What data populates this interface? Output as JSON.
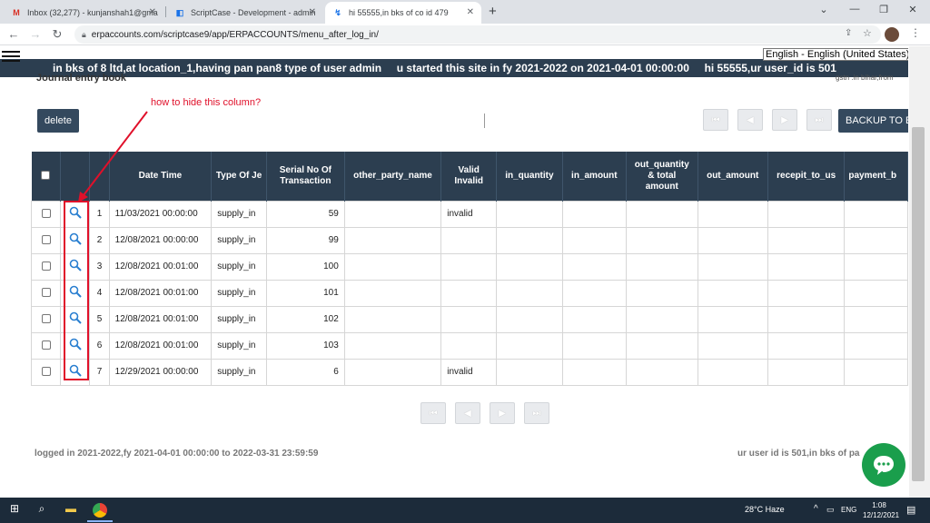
{
  "browser": {
    "tabs": [
      {
        "title": "Inbox (32,277) - kunjanshah1@gma",
        "icon": "gmail-icon",
        "active": false
      },
      {
        "title": "ScriptCase - Development - admin",
        "icon": "scriptcase-icon",
        "active": false
      },
      {
        "title": "hi 55555,in bks of co id 479",
        "icon": "page-icon",
        "active": true
      }
    ],
    "new_tab": "+",
    "url": "erpaccounts.com/scriptcase9/app/ERPACCOUNTS/menu_after_log_in/"
  },
  "header": {
    "banner": "in bks of 8 ltd,at location_1,having pan pan8 type of user admin     u started this site in fy 2021-2022 on 2021-04-01 00:00:00     hi 55555,ur user_id is 501",
    "language": "English - English (United States)",
    "title": "Journal entry book",
    "gstn": "gstn .in bihar,from"
  },
  "toolbar": {
    "delete_label": "delete",
    "backup_label": "BACKUP TO EX"
  },
  "table": {
    "columns": [
      "",
      "",
      "",
      "Date Time",
      "Type Of Je",
      "Serial No Of Transaction",
      "other_party_name",
      "Valid Invalid",
      "in_quantity",
      "in_amount",
      "out_quantity & total amount",
      "out_amount",
      "recepit_to_us",
      "payment_b"
    ],
    "rows": [
      {
        "num": "1",
        "date": "11/03/2021 00:00:00",
        "type": "supply_in",
        "serial": "59",
        "other": "",
        "valid": "invalid"
      },
      {
        "num": "2",
        "date": "12/08/2021 00:00:00",
        "type": "supply_in",
        "serial": "99",
        "other": "",
        "valid": ""
      },
      {
        "num": "3",
        "date": "12/08/2021 00:01:00",
        "type": "supply_in",
        "serial": "100",
        "other": "",
        "valid": ""
      },
      {
        "num": "4",
        "date": "12/08/2021 00:01:00",
        "type": "supply_in",
        "serial": "101",
        "other": "",
        "valid": ""
      },
      {
        "num": "5",
        "date": "12/08/2021 00:01:00",
        "type": "supply_in",
        "serial": "102",
        "other": "",
        "valid": ""
      },
      {
        "num": "6",
        "date": "12/08/2021 00:01:00",
        "type": "supply_in",
        "serial": "103",
        "other": "",
        "valid": ""
      },
      {
        "num": "7",
        "date": "12/29/2021 00:00:00",
        "type": "supply_in",
        "serial": "6",
        "other": "",
        "valid": "invalid"
      }
    ]
  },
  "footer": {
    "left": "logged in 2021-2022,fy 2021-04-01 00:00:00 to 2022-03-31 23:59:59",
    "right": "ur user id is 501,in bks of pa"
  },
  "annotation": {
    "text": "how to hide this column?",
    "color": "#e0102a"
  },
  "taskbar": {
    "weather": "28°C  Haze",
    "lang": "ENG",
    "time": "1:08",
    "date": "12/12/2021"
  },
  "colors": {
    "header_bg": "#2c3e50",
    "accent_green": "#1a9e4c"
  }
}
